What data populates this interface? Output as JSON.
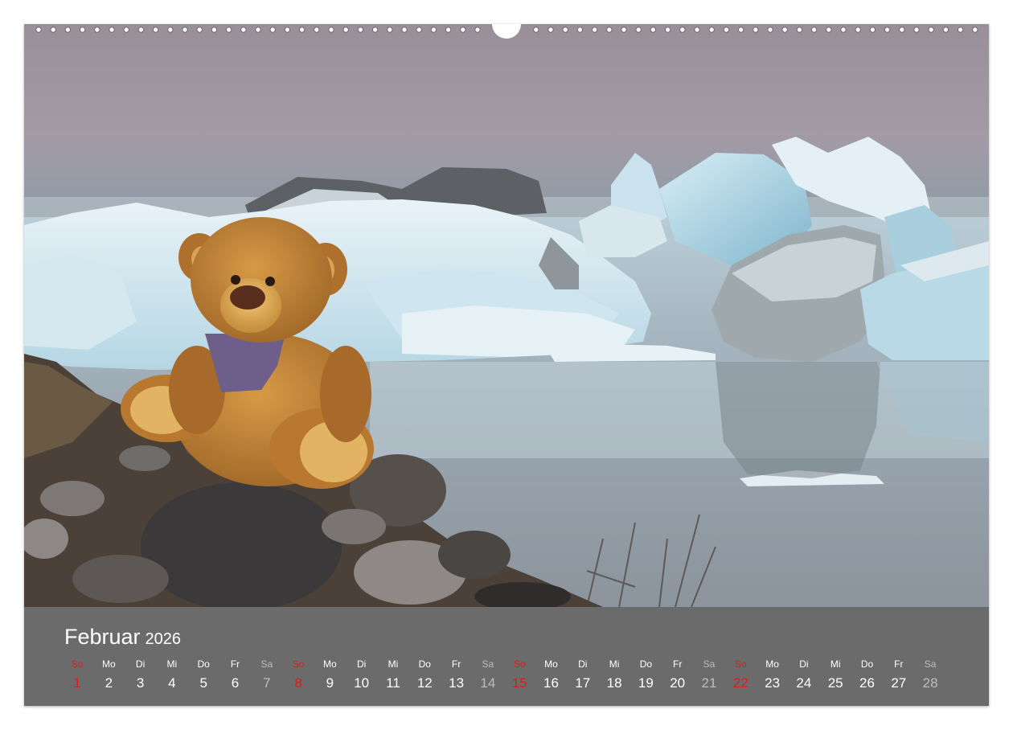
{
  "calendar": {
    "month": "Februar",
    "year": "2026",
    "days": [
      {
        "wd": "So",
        "d": "1",
        "type": "sun"
      },
      {
        "wd": "Mo",
        "d": "2",
        "type": "week"
      },
      {
        "wd": "Di",
        "d": "3",
        "type": "week"
      },
      {
        "wd": "Mi",
        "d": "4",
        "type": "week"
      },
      {
        "wd": "Do",
        "d": "5",
        "type": "week"
      },
      {
        "wd": "Fr",
        "d": "6",
        "type": "week"
      },
      {
        "wd": "Sa",
        "d": "7",
        "type": "sat"
      },
      {
        "wd": "So",
        "d": "8",
        "type": "sun"
      },
      {
        "wd": "Mo",
        "d": "9",
        "type": "week"
      },
      {
        "wd": "Di",
        "d": "10",
        "type": "week"
      },
      {
        "wd": "Mi",
        "d": "11",
        "type": "week"
      },
      {
        "wd": "Do",
        "d": "12",
        "type": "week"
      },
      {
        "wd": "Fr",
        "d": "13",
        "type": "week"
      },
      {
        "wd": "Sa",
        "d": "14",
        "type": "sat"
      },
      {
        "wd": "So",
        "d": "15",
        "type": "sun"
      },
      {
        "wd": "Mo",
        "d": "16",
        "type": "week"
      },
      {
        "wd": "Di",
        "d": "17",
        "type": "week"
      },
      {
        "wd": "Mi",
        "d": "18",
        "type": "week"
      },
      {
        "wd": "Do",
        "d": "19",
        "type": "week"
      },
      {
        "wd": "Fr",
        "d": "20",
        "type": "week"
      },
      {
        "wd": "Sa",
        "d": "21",
        "type": "sat"
      },
      {
        "wd": "So",
        "d": "22",
        "type": "sun"
      },
      {
        "wd": "Mo",
        "d": "23",
        "type": "week"
      },
      {
        "wd": "Di",
        "d": "24",
        "type": "week"
      },
      {
        "wd": "Mi",
        "d": "25",
        "type": "week"
      },
      {
        "wd": "Do",
        "d": "26",
        "type": "week"
      },
      {
        "wd": "Fr",
        "d": "27",
        "type": "week"
      },
      {
        "wd": "Sa",
        "d": "28",
        "type": "sat"
      }
    ]
  },
  "colors": {
    "panel": "#6b6b6b",
    "sunday": "#d8201c",
    "saturday": "#bdbdbd",
    "text": "#ffffff"
  }
}
